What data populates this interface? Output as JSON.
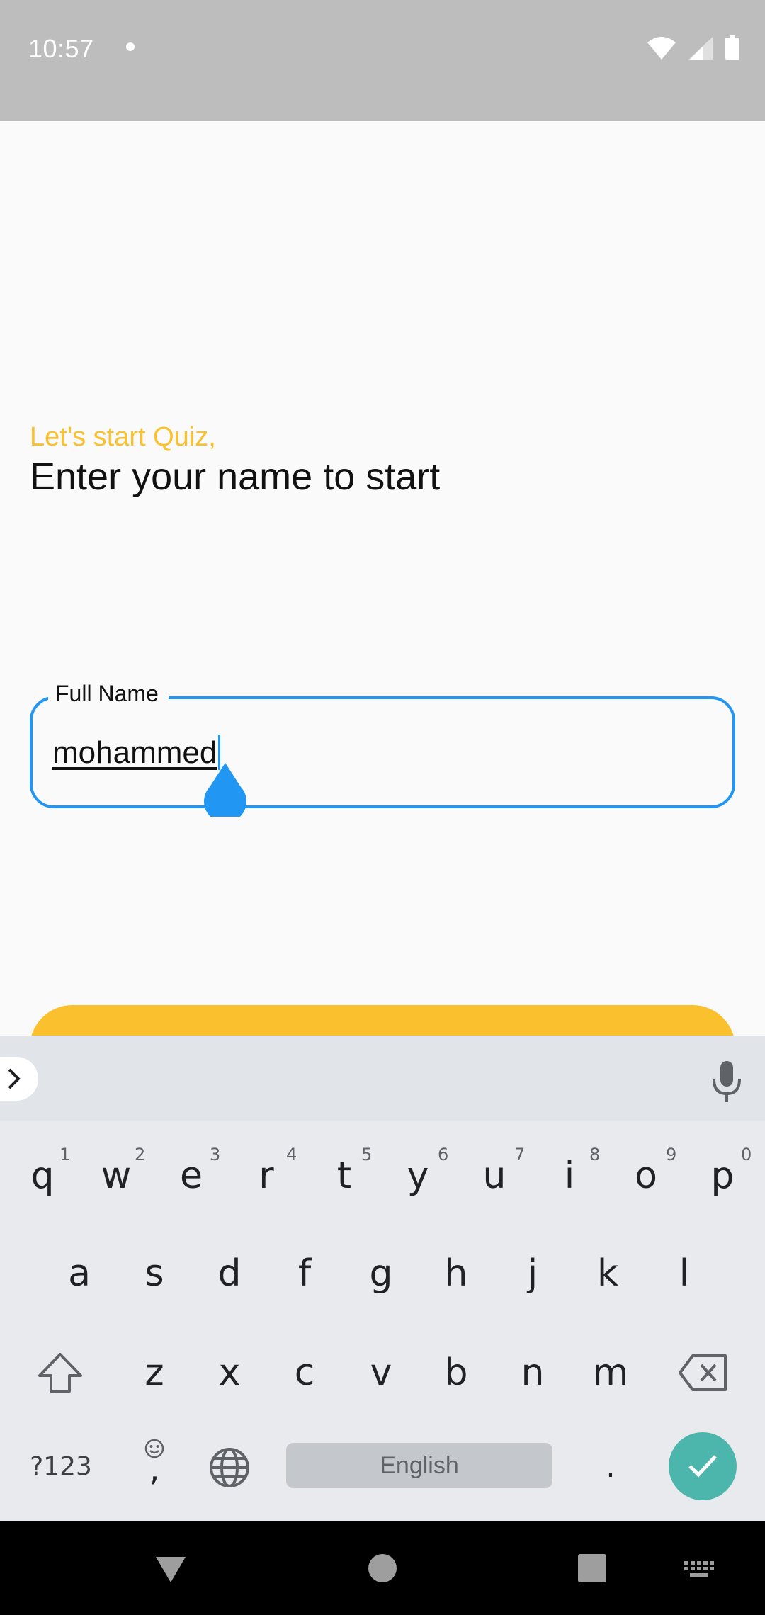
{
  "status_bar": {
    "time": "10:57"
  },
  "intro": {
    "subtitle": "Let's start Quiz,",
    "title": "Enter your name to start"
  },
  "name_field": {
    "label": "Full Name",
    "value": "mohammed"
  },
  "keyboard": {
    "row1": [
      {
        "letter": "q",
        "hint": "1"
      },
      {
        "letter": "w",
        "hint": "2"
      },
      {
        "letter": "e",
        "hint": "3"
      },
      {
        "letter": "r",
        "hint": "4"
      },
      {
        "letter": "t",
        "hint": "5"
      },
      {
        "letter": "y",
        "hint": "6"
      },
      {
        "letter": "u",
        "hint": "7"
      },
      {
        "letter": "i",
        "hint": "8"
      },
      {
        "letter": "o",
        "hint": "9"
      },
      {
        "letter": "p",
        "hint": "0"
      }
    ],
    "row2": [
      "a",
      "s",
      "d",
      "f",
      "g",
      "h",
      "j",
      "k",
      "l"
    ],
    "row3": [
      "z",
      "x",
      "c",
      "v",
      "b",
      "n",
      "m"
    ],
    "symbols_label": "?123",
    "comma_label": ",",
    "space_label": "English",
    "period_label": "."
  },
  "colors": {
    "accent": "#2196f3",
    "brand": "#fbc02d",
    "enter": "#4db6ac"
  }
}
